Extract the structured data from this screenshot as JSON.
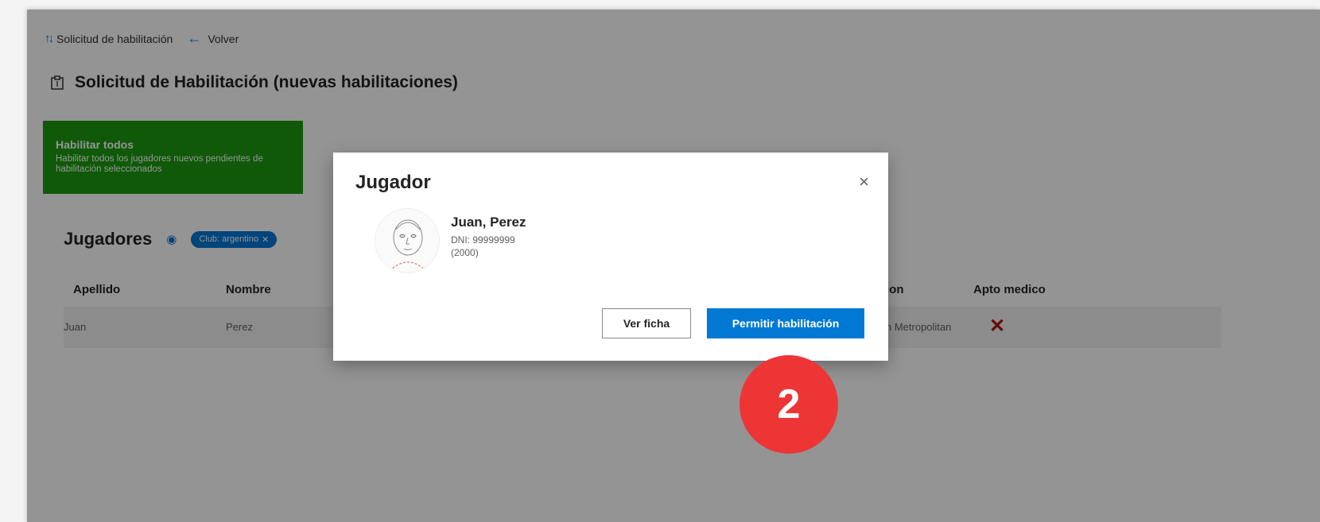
{
  "breadcrumb": {
    "current": "Solicitud de habilitación",
    "back_label": "Volver"
  },
  "page_title": "Solicitud de Habilitación (nuevas habilitaciones)",
  "enable_all": {
    "title": "Habilitar todos",
    "description": "Habilitar todos los jugadores nuevos pendientes de habilitación seleccionados"
  },
  "players": {
    "title": "Jugadores",
    "filter_chip": "Club: argentino",
    "filter_chip_close": "✕",
    "columns": [
      "Apellido",
      "Nombre",
      "ion",
      "Apto medico"
    ],
    "rows": [
      {
        "apellido": "Juan",
        "nombre": "Perez",
        "ion": "n Metropolitan",
        "apto_medico": "✕"
      }
    ]
  },
  "modal": {
    "title": "Jugador",
    "close_glyph": "×",
    "player_name": "Juan, Perez",
    "dni": "DNI: 99999999",
    "year": "(2000)",
    "view_button": "Ver ficha",
    "allow_button": "Permitir habilitación"
  },
  "step_badge": "2",
  "colors": {
    "accent": "#0078d4",
    "enable_card": "#1a9a0f",
    "badge": "#ee3536",
    "error_x": "#b0140b"
  },
  "icons": {
    "sort": "sort-arrows-icon",
    "back": "arrow-left-icon",
    "title": "clipboard-icon",
    "eye": "eye-icon",
    "close": "close-icon"
  }
}
